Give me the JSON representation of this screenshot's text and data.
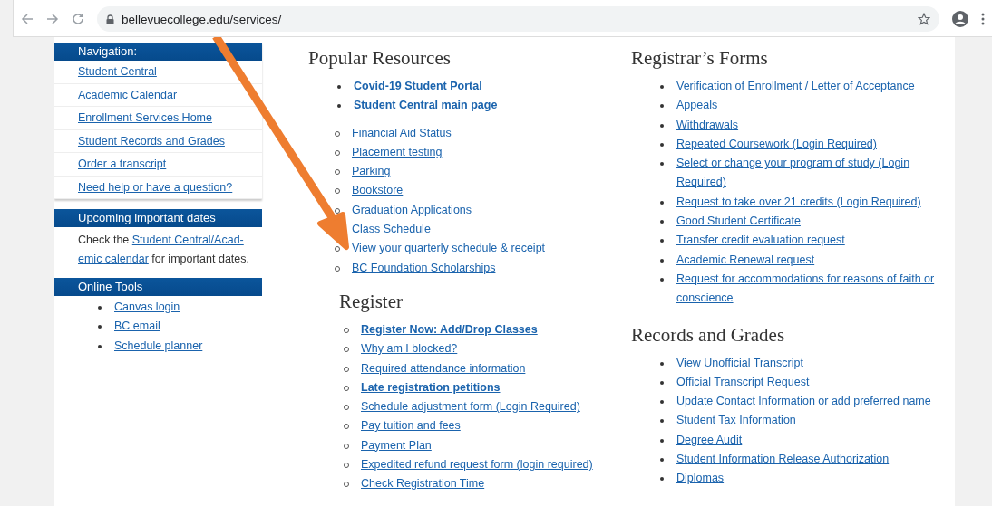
{
  "browser": {
    "url": "bellevuecollege.edu/services/"
  },
  "sidebar": {
    "navigation": {
      "title": "Navigation:",
      "items": [
        "Student Central",
        "Academic Calendar",
        "Enrollment Services Home",
        "Student Records and Grades",
        "Order a transcript",
        "Need help or have a question?"
      ]
    },
    "dates": {
      "title": "Upcoming important dates",
      "before": "Check the",
      "link_lines": [
        "Student Central/Acad-",
        "emic calendar"
      ],
      "after": "for important dates."
    },
    "tools": {
      "title": "Online Tools",
      "items": [
        "Canvas login",
        "BC email",
        "Schedule planner"
      ]
    }
  },
  "popular_resources": {
    "title": "Popular Resources",
    "items": [
      {
        "label": "Covid-19 Student Portal",
        "bold": true
      },
      {
        "label": "Student Central main page",
        "bold": true,
        "children": [
          {
            "label": "Financial Aid Status",
            "bold": false
          },
          {
            "label": "Placement testing",
            "bold": false
          },
          {
            "label": "Parking",
            "bold": false
          },
          {
            "label": "Bookstore",
            "bold": false
          },
          {
            "label": "Graduation Applications",
            "bold": false
          },
          {
            "label": "Class Schedule",
            "bold": false
          },
          {
            "label": "View your quarterly schedule & receipt",
            "bold": false
          },
          {
            "label": "BC Foundation Scholarships",
            "bold": false
          }
        ]
      }
    ]
  },
  "register": {
    "title": "Register",
    "items": [
      {
        "label": "Register Now: Add/Drop Classes",
        "bold": true
      },
      {
        "label": "Why am I blocked?",
        "bold": false
      },
      {
        "label": "Required attendance information",
        "bold": false
      },
      {
        "label": "Late registration petitions",
        "bold": true
      },
      {
        "label": "Schedule adjustment form (Login Required)",
        "bold": false
      },
      {
        "label": "Pay tuition and fees",
        "bold": false
      },
      {
        "label": "Payment Plan",
        "bold": false
      },
      {
        "label": "Expedited refund request form (login required)",
        "bold": false
      },
      {
        "label": "Check Registration Time",
        "bold": false
      }
    ]
  },
  "registrars_forms": {
    "title": "Registrar’s Forms",
    "items": [
      {
        "label": "Verification of Enrollment / Letter of Acceptance",
        "bold": false
      },
      {
        "label": "Appeals",
        "bold": false
      },
      {
        "label": "Withdrawals",
        "bold": false
      },
      {
        "label": "Repeated Coursework (Login Required)",
        "bold": false
      },
      {
        "label": "Select or change your program of study (Login Required)",
        "bold": false
      },
      {
        "label": "Request to take over 21 credits (Login Required)",
        "bold": false
      },
      {
        "label": "Good Student Certificate",
        "bold": false
      },
      {
        "label": "Transfer credit evaluation request",
        "bold": false
      },
      {
        "label": "Academic Renewal request",
        "bold": false
      },
      {
        "label": "Request for accommodations for reasons of faith or conscience",
        "bold": false
      }
    ]
  },
  "records_and_grades": {
    "title": "Records and Grades",
    "items": [
      {
        "label": "View Unofficial Transcript",
        "bold": false
      },
      {
        "label": "Official Transcript Request",
        "bold": false
      },
      {
        "label": "Update Contact Information or add preferred name",
        "bold": false
      },
      {
        "label": "Student Tax Information",
        "bold": false
      },
      {
        "label": "Degree Audit",
        "bold": false
      },
      {
        "label": "Student Information Release Authorization",
        "bold": false
      },
      {
        "label": "Diplomas",
        "bold": false
      }
    ]
  }
}
